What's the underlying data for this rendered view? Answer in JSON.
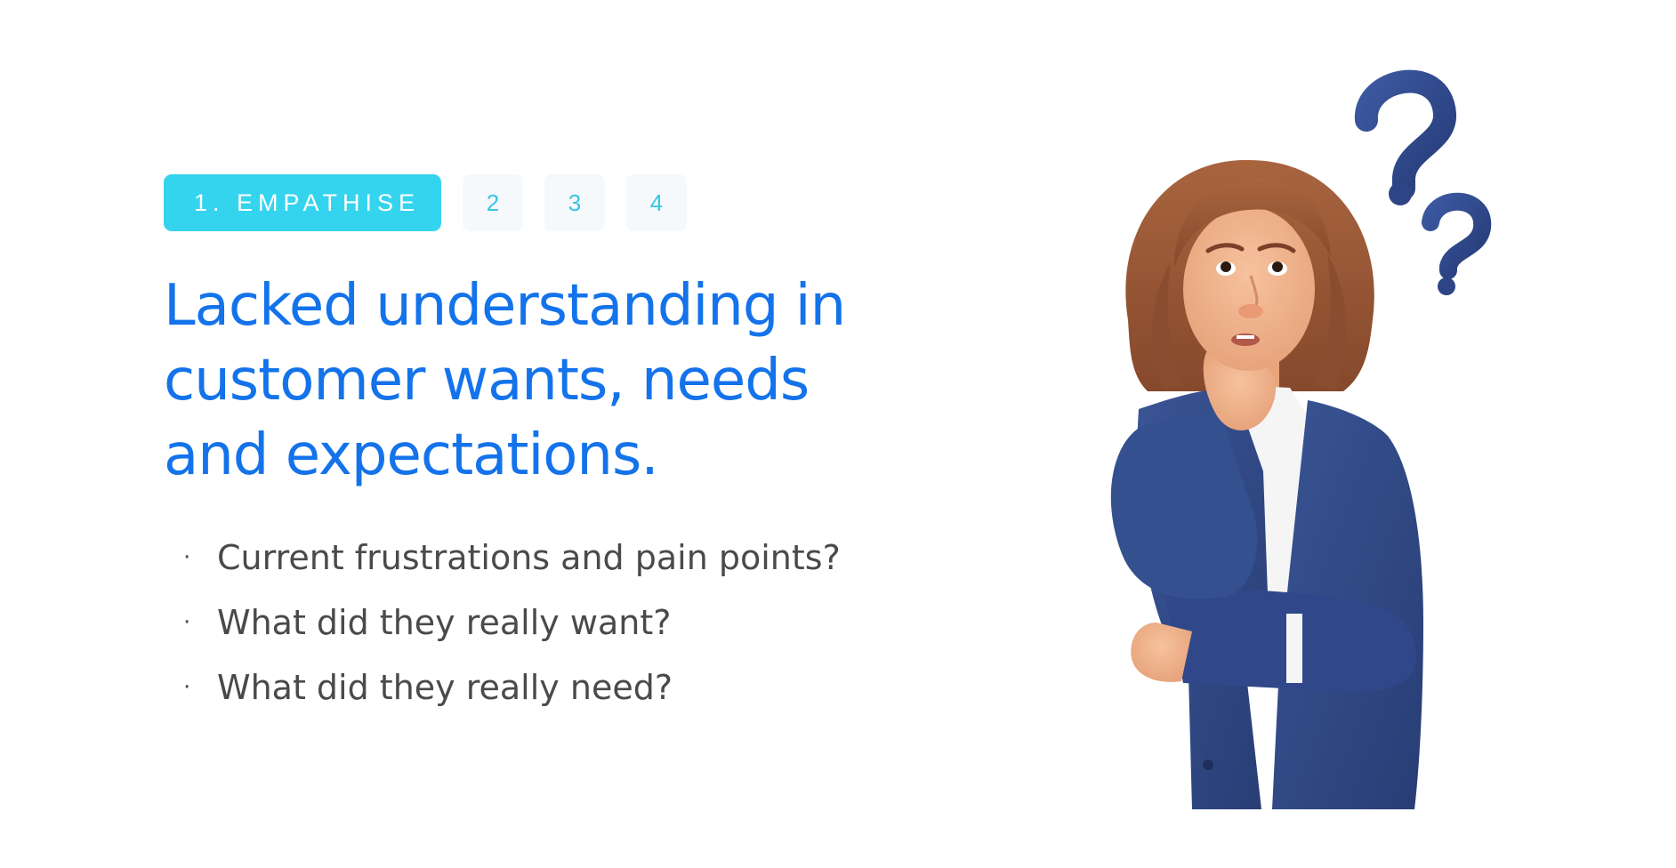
{
  "steps": {
    "active_label": "1. EMPATHISE",
    "items": [
      "2",
      "3",
      "4"
    ]
  },
  "headline": {
    "line1": "Lacked understanding in",
    "line2": "customer wants, needs",
    "line3": "and expectations."
  },
  "bullets": [
    "Current frustrations and pain points?",
    "What did they really want?",
    "What did they really need?"
  ],
  "bullet_symbol": "·",
  "colors": {
    "accent_cyan": "#35d4ee",
    "headline_blue": "#1473ea",
    "body_text": "#4a4a4a",
    "suit_navy": "#2f4680",
    "hair_brown": "#93583a",
    "skin": "#f0b088",
    "question_mark": "#2d4584"
  },
  "illustration": {
    "icon": "thinking-woman-illustration",
    "decoration_icon": "question-marks-icon"
  }
}
